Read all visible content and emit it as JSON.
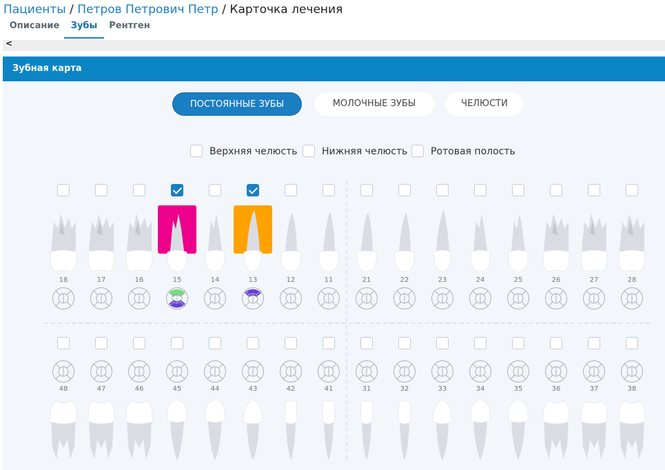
{
  "breadcrumb": {
    "patients": "Пациенты",
    "sep1": "/",
    "patient": "Петров Петрович Петр",
    "sep2": "/",
    "current": "Карточка лечения"
  },
  "tabs": [
    {
      "label": "Описание"
    },
    {
      "label": "Зубы",
      "active": true
    },
    {
      "label": "Рентген"
    }
  ],
  "scroll": {
    "left_icon": "chevron-left-icon",
    "arrow": "<"
  },
  "panel": {
    "title": "Зубная карта"
  },
  "dentition_buttons": [
    {
      "label": "ПОСТОЯННЫЕ ЗУБЫ",
      "active": true
    },
    {
      "label": "МОЛОЧНЫЕ ЗУБЫ",
      "active": false
    },
    {
      "label": "ЧЕЛЮСТИ",
      "active": false
    }
  ],
  "jaw_options": [
    {
      "label": "Верхняя челюсть",
      "checked": false
    },
    {
      "label": "Нижняя челюсть",
      "checked": false
    },
    {
      "label": "Ротовая полость",
      "checked": false
    }
  ],
  "upper_teeth": [
    {
      "num": "18",
      "checked": false,
      "highlight": null
    },
    {
      "num": "17",
      "checked": false,
      "highlight": null
    },
    {
      "num": "16",
      "checked": false,
      "highlight": null
    },
    {
      "num": "15",
      "checked": true,
      "highlight": "#ec008c"
    },
    {
      "num": "14",
      "checked": false,
      "highlight": null
    },
    {
      "num": "13",
      "checked": true,
      "highlight": "#ffa200"
    },
    {
      "num": "12",
      "checked": false,
      "highlight": null
    },
    {
      "num": "11",
      "checked": false,
      "highlight": null
    },
    {
      "num": "21",
      "checked": false,
      "highlight": null
    },
    {
      "num": "22",
      "checked": false,
      "highlight": null
    },
    {
      "num": "23",
      "checked": false,
      "highlight": null
    },
    {
      "num": "24",
      "checked": false,
      "highlight": null
    },
    {
      "num": "25",
      "checked": false,
      "highlight": null
    },
    {
      "num": "26",
      "checked": false,
      "highlight": null
    },
    {
      "num": "27",
      "checked": false,
      "highlight": null
    },
    {
      "num": "28",
      "checked": false,
      "highlight": null
    }
  ],
  "lower_teeth": [
    {
      "num": "48",
      "checked": false
    },
    {
      "num": "47",
      "checked": false
    },
    {
      "num": "46",
      "checked": false
    },
    {
      "num": "45",
      "checked": false
    },
    {
      "num": "44",
      "checked": false
    },
    {
      "num": "43",
      "checked": false
    },
    {
      "num": "42",
      "checked": false
    },
    {
      "num": "41",
      "checked": false
    },
    {
      "num": "31",
      "checked": false
    },
    {
      "num": "32",
      "checked": false
    },
    {
      "num": "33",
      "checked": false
    },
    {
      "num": "34",
      "checked": false
    },
    {
      "num": "35",
      "checked": false
    },
    {
      "num": "36",
      "checked": false
    },
    {
      "num": "37",
      "checked": false
    },
    {
      "num": "38",
      "checked": false
    }
  ],
  "surface_marks": {
    "15": {
      "top": "#6ee07a",
      "bottom": "#6a3fd8"
    },
    "13": {
      "top": "#6a3fd8"
    }
  },
  "colors": {
    "accent": "#1a7ec2",
    "header": "#0b85c6",
    "tooth_root": "#d9dde3",
    "tooth_crown": "#ffffff"
  }
}
